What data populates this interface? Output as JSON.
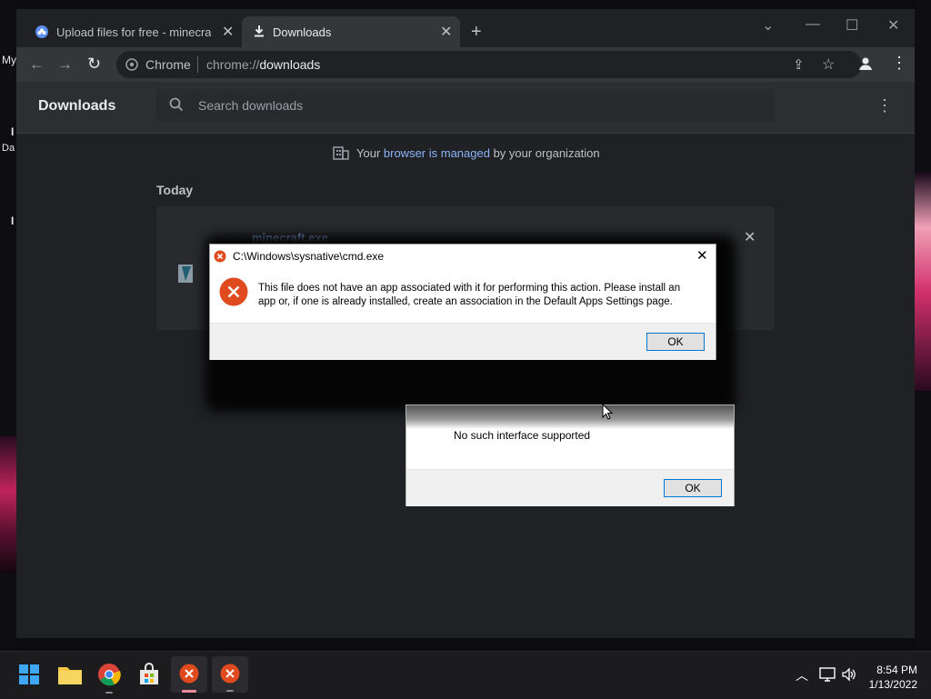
{
  "desktop": {
    "label_my": "My",
    "label_da": "Da",
    "label_i1": "I",
    "label_i2": "I"
  },
  "browser": {
    "tabs": [
      {
        "label": "Upload files for free - minecraft.e",
        "icon": "cloud-icon"
      },
      {
        "label": "Downloads",
        "icon": "download-icon"
      }
    ],
    "omnibox": {
      "prefix": "Chrome",
      "url_scheme": "chrome://",
      "url_path": "downloads"
    }
  },
  "downloads": {
    "title": "Downloads",
    "search_placeholder": "Search downloads",
    "managed_prefix": "Your ",
    "managed_link": "browser is managed",
    "managed_suffix": " by your organization",
    "section_today": "Today",
    "file_name": "minecraft.exe"
  },
  "dialog_cmd": {
    "title": "C:\\Windows\\sysnative\\cmd.exe",
    "message_line1": "This file does not have an app associated with it for performing this action. Please install an",
    "message_line2": "app or, if one is already installed, create an association in the Default Apps Settings page.",
    "ok_label": "OK"
  },
  "dialog_interface": {
    "message": "No such interface supported",
    "ok_label": "OK"
  },
  "taskbar": {
    "time": "8:54 PM",
    "date": "1/13/2022"
  },
  "colors": {
    "chrome_dark": "#202124",
    "link_blue": "#8ab4f8",
    "error_red": "#e04a1f",
    "taskbar": "#1c1c1f"
  }
}
